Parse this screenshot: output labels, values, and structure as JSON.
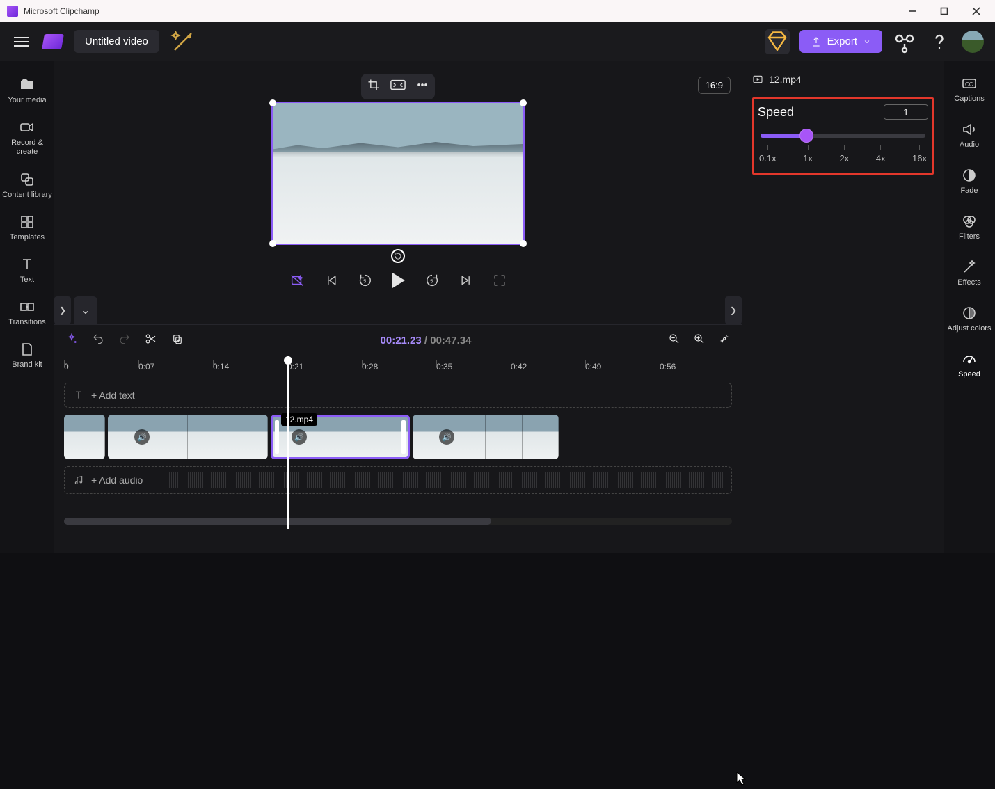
{
  "titlebar": {
    "title": "Microsoft Clipchamp"
  },
  "topbar": {
    "video_title": "Untitled video",
    "export_label": "Export"
  },
  "leftbar": {
    "items": [
      {
        "label": "Your media"
      },
      {
        "label": "Record & create"
      },
      {
        "label": "Content library"
      },
      {
        "label": "Templates"
      },
      {
        "label": "Text"
      },
      {
        "label": "Transitions"
      },
      {
        "label": "Brand kit"
      }
    ]
  },
  "preview": {
    "aspect": "16:9"
  },
  "timecode": {
    "current": "00:21.23",
    "duration": "00:47.34"
  },
  "ruler": [
    "0",
    "0:07",
    "0:14",
    "0:21",
    "0:28",
    "0:35",
    "0:42",
    "0:49",
    "0:56"
  ],
  "tracks": {
    "add_text_label": "+ Add text",
    "clip_label": "12.mp4",
    "add_audio_label": "+ Add audio"
  },
  "rightpanel": {
    "filename": "12.mp4",
    "speed_title": "Speed",
    "speed_value": "1",
    "ticks": [
      "0.1x",
      "1x",
      "2x",
      "4x",
      "16x"
    ]
  },
  "propbar": {
    "items": [
      {
        "label": "Captions"
      },
      {
        "label": "Audio"
      },
      {
        "label": "Fade"
      },
      {
        "label": "Filters"
      },
      {
        "label": "Effects"
      },
      {
        "label": "Adjust colors"
      },
      {
        "label": "Speed"
      }
    ]
  }
}
